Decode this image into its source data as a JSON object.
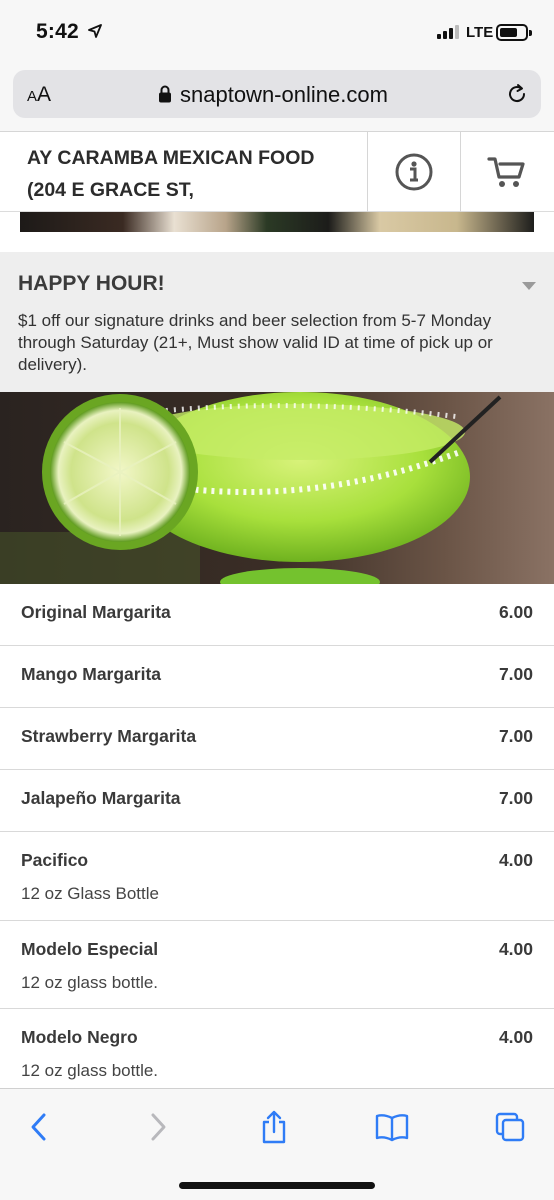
{
  "status_bar": {
    "time": "5:42",
    "network": "LTE"
  },
  "browser": {
    "text_size_label": "AA",
    "url": "snaptown-online.com"
  },
  "header": {
    "restaurant_name": "AY CARAMBA MEXICAN FOOD (204 E GRACE ST,"
  },
  "category": {
    "title": "HAPPY HOUR!",
    "description": "$1 off our signature drinks and beer selection from 5-7 Monday through Saturday (21+, Must show valid ID at time of pick up or delivery)."
  },
  "menu_items": [
    {
      "name": "Original Margarita",
      "price": "6.00",
      "description": ""
    },
    {
      "name": "Mango Margarita",
      "price": "7.00",
      "description": ""
    },
    {
      "name": "Strawberry Margarita",
      "price": "7.00",
      "description": ""
    },
    {
      "name": "Jalapeño Margarita",
      "price": "7.00",
      "description": ""
    },
    {
      "name": "Pacifico",
      "price": "4.00",
      "description": "12 oz Glass Bottle"
    },
    {
      "name": "Modelo Especial",
      "price": "4.00",
      "description": "12 oz glass bottle."
    },
    {
      "name": "Modelo Negro",
      "price": "4.00",
      "description": "12 oz glass bottle."
    }
  ],
  "colors": {
    "ios_blue": "#2f7cf6",
    "category_bg": "#eeeeee",
    "text_dark": "#3a3a3a"
  },
  "icons": [
    "location-arrow-icon",
    "signal-icon",
    "battery-icon",
    "lock-icon",
    "reload-icon",
    "info-icon",
    "cart-icon",
    "back-icon",
    "forward-icon",
    "share-icon",
    "bookmarks-icon",
    "tabs-icon",
    "caret-down-icon"
  ]
}
